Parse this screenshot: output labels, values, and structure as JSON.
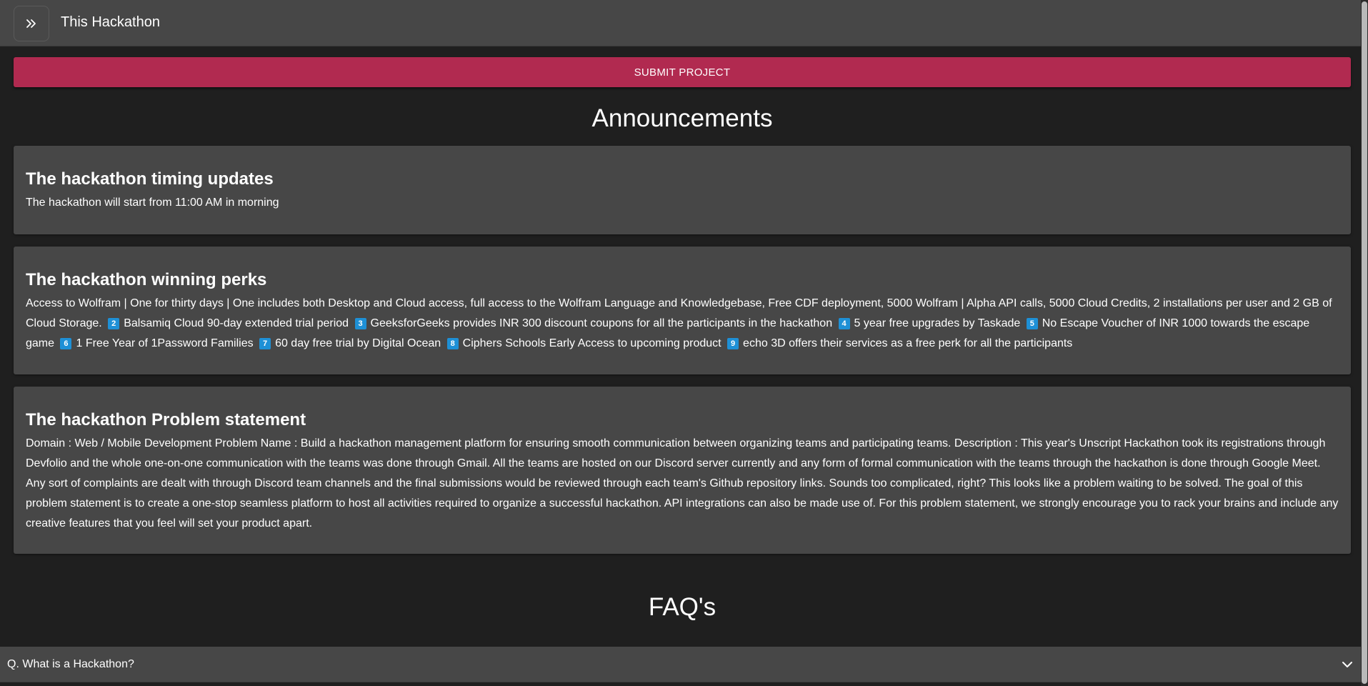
{
  "header": {
    "title": "This Hackathon",
    "menu_icon": "double-chevron-right-icon"
  },
  "submit_button": {
    "label": "SUBMIT PROJECT",
    "color": "#b12a50"
  },
  "announcements": {
    "heading": "Announcements",
    "items": [
      {
        "title": "The hackathon timing updates",
        "body": "The hackathon will start from 11:00 AM in morning"
      },
      {
        "title": "The hackathon winning perks",
        "parts": [
          "Access to Wolfram | One for thirty days | One includes both Desktop and Cloud access, full access to the Wolfram Language and Knowledgebase, Free CDF deployment, 5000 Wolfram | Alpha API calls, 5000 Cloud Credits, 2 installations per user and 2 GB of Cloud Storage.",
          "2",
          "Balsamiq Cloud 90-day extended trial period",
          "3",
          "GeeksforGeeks provides INR 300 discount coupons for all the participants in the hackathon",
          "4",
          "5 year free upgrades by Taskade",
          "5",
          "No Escape Voucher of INR 1000 towards the escape game",
          "6",
          "1 Free Year of 1Password Families",
          "7",
          "60 day free trial by Digital Ocean",
          "8",
          "Ciphers Schools Early Access to upcoming product",
          "9",
          "echo 3D offers their services as a free perk for all the participants"
        ]
      },
      {
        "title": "The hackathon Problem statement",
        "body": "Domain : Web / Mobile Development Problem Name : Build a hackathon management platform for ensuring smooth communication between organizing teams and participating teams. Description : This year's Unscript Hackathon took its registrations through Devfolio and the whole one-on-one communication with the teams was done through Gmail. All the teams are hosted on our Discord server currently and any form of formal communication with the teams through the hackathon is done through Google Meet. Any sort of complaints are dealt with through Discord team channels and the final submissions would be reviewed through each team's Github repository links. Sounds too complicated, right? This looks like a problem waiting to be solved. The goal of this problem statement is to create a one-stop seamless platform to host all activities required to organize a successful hackathon. API integrations can also be made use of. For this problem statement, we strongly encourage you to rack your brains and include any creative features that you feel will set your product apart."
      }
    ]
  },
  "faq": {
    "heading": "FAQ's",
    "items": [
      {
        "question": "Q. What is a Hackathon?",
        "icon": "chevron-down-icon"
      }
    ]
  }
}
